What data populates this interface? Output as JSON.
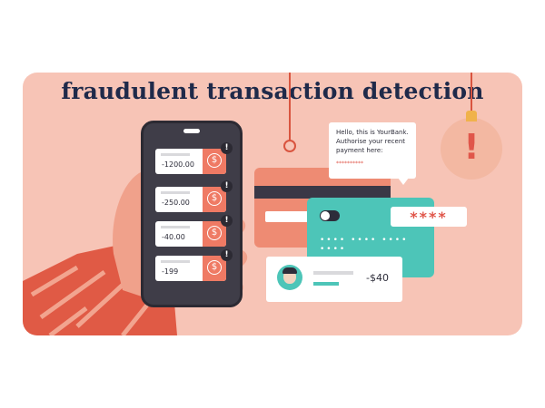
{
  "banner": {
    "title": "fraudulent transaction detection"
  },
  "phone": {
    "transactions": [
      {
        "amount": "-1200.00",
        "icon": "dollar-coin-icon"
      },
      {
        "amount": "-250.00",
        "icon": "dollar-coin-icon"
      },
      {
        "amount": "-40.00",
        "icon": "dollar-coin-icon"
      },
      {
        "amount": "-199",
        "icon": "dollar-coin-icon"
      }
    ],
    "alert_glyph": "!",
    "coin_glyph": "$"
  },
  "message": {
    "text": "Hello, this is YourBank. Authorise your recent payment here:",
    "masked": "**********"
  },
  "pin": {
    "text": "****"
  },
  "transaction_card": {
    "amount": "-$40"
  },
  "lamp": {
    "glyph": "!"
  },
  "colors": {
    "background": "#f7c4b6",
    "accent_red": "#ee8b73",
    "accent_teal": "#4dc5b8",
    "dark": "#2d2d3a"
  }
}
